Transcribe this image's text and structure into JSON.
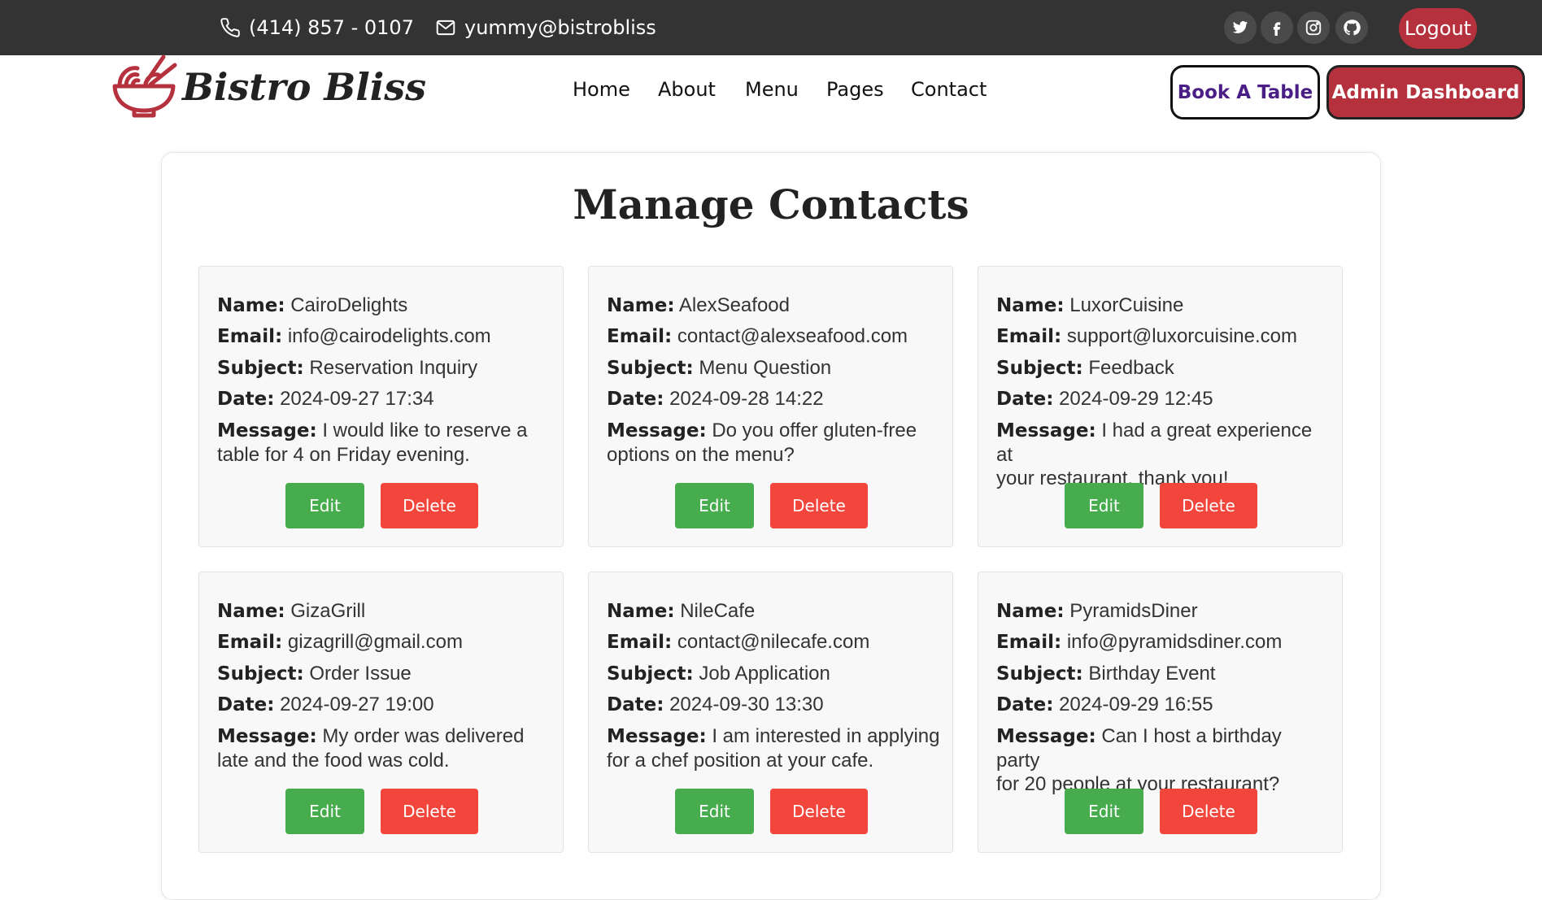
{
  "topbar": {
    "phone": "(414) 857 - 0107",
    "email": "yummy@bistrobliss",
    "social_icons": [
      "twitter-icon",
      "facebook-icon",
      "instagram-icon",
      "github-icon"
    ],
    "logout_label": "Logout"
  },
  "header": {
    "brand": "Bistro Bliss",
    "nav": [
      "Home",
      "About",
      "Menu",
      "Pages",
      "Contact"
    ],
    "book_label": "Book A Table",
    "admin_label": "Admin Dashboard"
  },
  "main": {
    "title": "Manage Contacts",
    "field_labels": {
      "name": "Name:",
      "email": "Email:",
      "subject": "Subject:",
      "date": "Date:",
      "message": "Message:"
    },
    "edit_label": "Edit",
    "delete_label": "Delete",
    "contacts": [
      {
        "name": "CairoDelights",
        "email": "info@cairodelights.com",
        "subject": "Reservation Inquiry",
        "date": "2024-09-27 17:34",
        "message_line1": "I would like to reserve a",
        "message_line2": "table for 4 on Friday evening."
      },
      {
        "name": "AlexSeafood",
        "email": "contact@alexseafood.com",
        "subject": "Menu Question",
        "date": "2024-09-28 14:22",
        "message_line1": "Do you offer gluten-free",
        "message_line2": "options on the menu?"
      },
      {
        "name": "LuxorCuisine",
        "email": "support@luxorcuisine.com",
        "subject": "Feedback",
        "date": "2024-09-29 12:45",
        "message_line1": "I had a great experience at",
        "message_line2": "your restaurant, thank you!"
      },
      {
        "name": "GizaGrill",
        "email": "gizagrill@gmail.com",
        "subject": "Order Issue",
        "date": "2024-09-27 19:00",
        "message_line1": "My order was delivered",
        "message_line2": "late and the food was cold."
      },
      {
        "name": "NileCafe",
        "email": "contact@nilecafe.com",
        "subject": "Job Application",
        "date": "2024-09-30 13:30",
        "message_line1": "I am interested in applying",
        "message_line2": "for a chef position at your cafe."
      },
      {
        "name": "PyramidsDiner",
        "email": "info@pyramidsdiner.com",
        "subject": "Birthday Event",
        "date": "2024-09-29 16:55",
        "message_line1": "Can I host a birthday party",
        "message_line2": "for 20 people at your restaurant?"
      }
    ]
  },
  "colors": {
    "topbar": "#333333",
    "brand_red": "#b5313d",
    "edit_green": "#46ac4d",
    "delete_red": "#f2453b",
    "book_text": "#4b1e86"
  }
}
